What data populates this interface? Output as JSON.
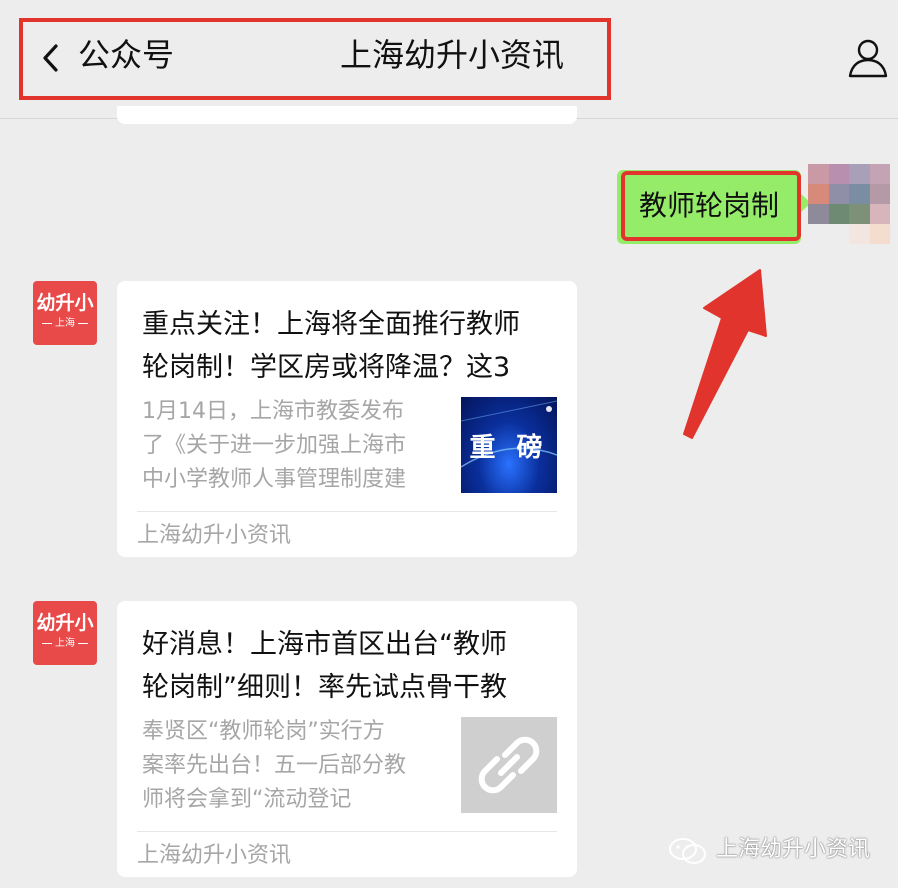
{
  "header": {
    "back_label": "公众号",
    "title": "上海幼升小资讯",
    "profile_icon": "person-icon"
  },
  "outgoing_message": {
    "text": "教师轮岗制",
    "bubble_color": "#95ec69"
  },
  "messages": [
    {
      "avatar_line1": "幼升小",
      "avatar_line2": "上海",
      "title": "重点关注！上海将全面推行教师\n轮岗制！学区房或将降温？这3",
      "desc": "1月14日，上海市教委发布\n了《关于进一步加强上海市\n中小学教师人事管理制度建",
      "thumb_label": "重 磅",
      "source": "上海幼升小资讯"
    },
    {
      "avatar_line1": "幼升小",
      "avatar_line2": "上海",
      "title": "好消息！上海市首区出台“教师\n轮岗制”细则！率先试点骨干教",
      "desc": "奉贤区“教师轮岗”实行方\n案率先出台！五一后部分教\n师将会拿到“流动登记",
      "thumb_icon": "link-icon",
      "source": "上海幼升小资讯"
    }
  ],
  "watermark": {
    "text": "上海幼升小资讯",
    "icon": "wechat-icon"
  },
  "colors": {
    "highlight": "#e0342c",
    "avatar": "#e84a4a",
    "background": "#ededed"
  }
}
